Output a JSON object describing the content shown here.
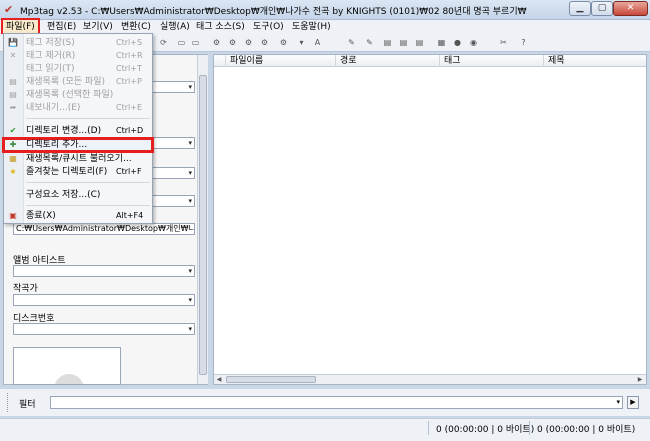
{
  "window": {
    "title": "Mp3tag v2.53  -  C:₩Users₩Administrator₩Desktop₩개인₩나가수 전곡 by KNIGHTS (0101)₩02 80년대 명곡 부르기₩",
    "min_label": "▁",
    "max_label": "▢",
    "close_label": "✕"
  },
  "menubar": {
    "items": [
      "파일(F)",
      "편집(E)",
      "보기(V)",
      "변환(C)",
      "실행(A)",
      "태그 소스(S)",
      "도구(O)",
      "도움말(H)"
    ]
  },
  "file_menu": {
    "items": [
      {
        "label": "태그 저장(S)",
        "shortcut": "Ctrl+S",
        "icon": "save-icon",
        "glyph": "💾"
      },
      {
        "label": "태그 제거(R)",
        "shortcut": "Ctrl+R",
        "icon": "remove-icon",
        "glyph": "✕"
      },
      {
        "label": "태그 읽기(T)",
        "shortcut": "Ctrl+T",
        "icon": "",
        "glyph": ""
      },
      {
        "label": "재생목록 (모든 파일)",
        "shortcut": "Ctrl+P",
        "icon": "playlist-icon",
        "glyph": "▤"
      },
      {
        "label": "재생목록 (선택한 파일)",
        "shortcut": "",
        "icon": "playlist-selected-icon",
        "glyph": "▤"
      },
      {
        "label": "내보내기...(E)",
        "shortcut": "Ctrl+E",
        "icon": "export-icon",
        "glyph": "➦"
      },
      {
        "label": "디렉토리 변경...(D)",
        "shortcut": "Ctrl+D",
        "icon": "change-directory-icon",
        "glyph": "✔"
      },
      {
        "label": "디렉토리 추가...",
        "shortcut": "",
        "icon": "add-directory-icon",
        "glyph": "✚"
      },
      {
        "label": "재생목록/큐시트 불러오기...",
        "shortcut": "",
        "icon": "load-playlist-icon",
        "glyph": "▦"
      },
      {
        "label": "즐겨찾는 디렉토리(F)",
        "shortcut": "Ctrl+F",
        "icon": "favorites-star-icon",
        "glyph": "★"
      },
      {
        "label": "구성요소 저장...(C)",
        "shortcut": "",
        "icon": "",
        "glyph": ""
      },
      {
        "label": "종료(X)",
        "shortcut": "Alt+F4",
        "icon": "exit-icon",
        "glyph": "▣"
      }
    ]
  },
  "tag_panel": {
    "path_value": "C:₩Users₩Administrator₩Desktop₩개인₩니",
    "album_artist_label": "앨범 아티스트",
    "composer_label": "작곡가",
    "discnumber_label": "디스크번호"
  },
  "file_list": {
    "columns": [
      "파일이름",
      "경로",
      "태그",
      "제목"
    ]
  },
  "filter": {
    "label": "필터",
    "value": ""
  },
  "status": {
    "selected": "0 (00:00:00 | 0 바이트)",
    "total": "0 (00:00:00 | 0 바이트)"
  },
  "colors": {
    "highlight": "#e51e1e",
    "menu_active_bg": "#f7e9c9"
  }
}
